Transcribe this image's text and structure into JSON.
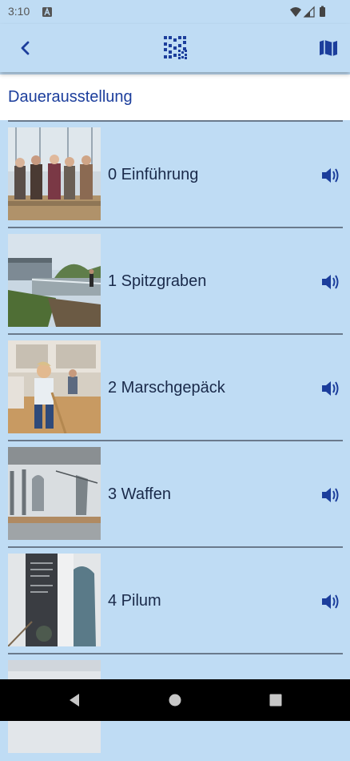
{
  "status_bar": {
    "time": "3:10"
  },
  "header": {
    "icons": [
      "back-arrow-icon",
      "qr-code-icon",
      "map-icon"
    ]
  },
  "section": {
    "title": "Dauerausstellung"
  },
  "items": [
    {
      "label": "0 Einführung"
    },
    {
      "label": "1 Spitzgraben"
    },
    {
      "label": "2 Marschgepäck"
    },
    {
      "label": "3 Waffen"
    },
    {
      "label": "4 Pilum"
    }
  ],
  "colors": {
    "background": "#bfdcf4",
    "accent": "#1c3e9c",
    "divider": "#6a7a8c"
  }
}
